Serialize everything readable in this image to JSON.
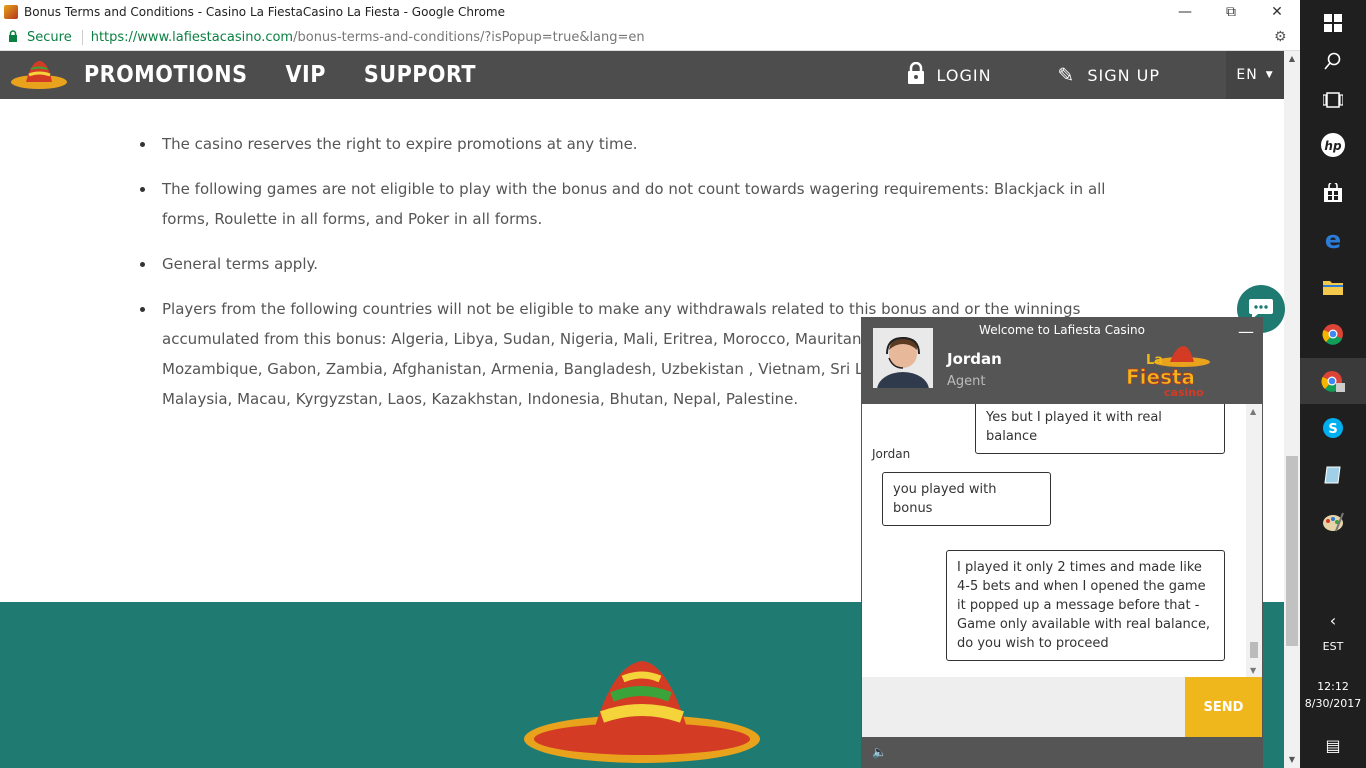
{
  "browser": {
    "tab_title": "Bonus Terms and Conditions - Casino La FiestaCasino La Fiesta - Google Chrome",
    "secure_label": "Secure",
    "url_host": "https://www.lafiestacasino.com",
    "url_path": "/bonus-terms-and-conditions/?isPopup=true&lang=en"
  },
  "nav": {
    "items": [
      "PROMOTIONS",
      "VIP",
      "SUPPORT"
    ],
    "login": "LOGIN",
    "signup": "SIGN UP",
    "lang": "EN"
  },
  "terms": [
    "The casino reserves the right to expire promotions at any time.",
    "The following games are not eligible to play with the bonus and do not count towards wagering requirements: Blackjack in all forms, Roulette in all forms, and Poker in all forms.",
    "General terms apply.",
    "Players from the following countries will not be eligible to make any withdrawals related to this bonus and or the winnings accumulated from this bonus: Algeria, Libya, Sudan, Nigeria, Mali, Eritrea, Morocco, Mauritania, Djibouti, Angola, Namibia, Mozambique, Gabon, Zambia, Afghanistan, Armenia, Bangladesh, Uzbekistan , Vietnam, Sri Lanka, Pakistan, North Korea, Malaysia, Macau, Kyrgyzstan, Laos, Kazakhstan, Indonesia, Bhutan, Nepal, Palestine."
  ],
  "chat": {
    "welcome": "Welcome to Lafiesta Casino",
    "agent_name": "Jordan",
    "agent_role": "Agent",
    "brand_top": "La",
    "brand_main": "Fiesta",
    "brand_sub": "casino",
    "messages": [
      {
        "text": "Yes but I played it with real balance"
      },
      {
        "sender": "Jordan",
        "text": "you played with bonus"
      },
      {
        "text": "I played it only 2 times and made like 4-5 bets and when I opened the game it popped up a message before that - Game only available with real balance, do you wish to proceed"
      }
    ],
    "send_label": "SEND"
  },
  "taskbar": {
    "tz": "EST",
    "time": "12:12",
    "date": "8/30/2017"
  },
  "colors": {
    "nav_bg": "#4d4d4d",
    "footer_bg": "#1f7b72",
    "send_bg": "#f0b71d",
    "secure_green": "#0b8043"
  }
}
